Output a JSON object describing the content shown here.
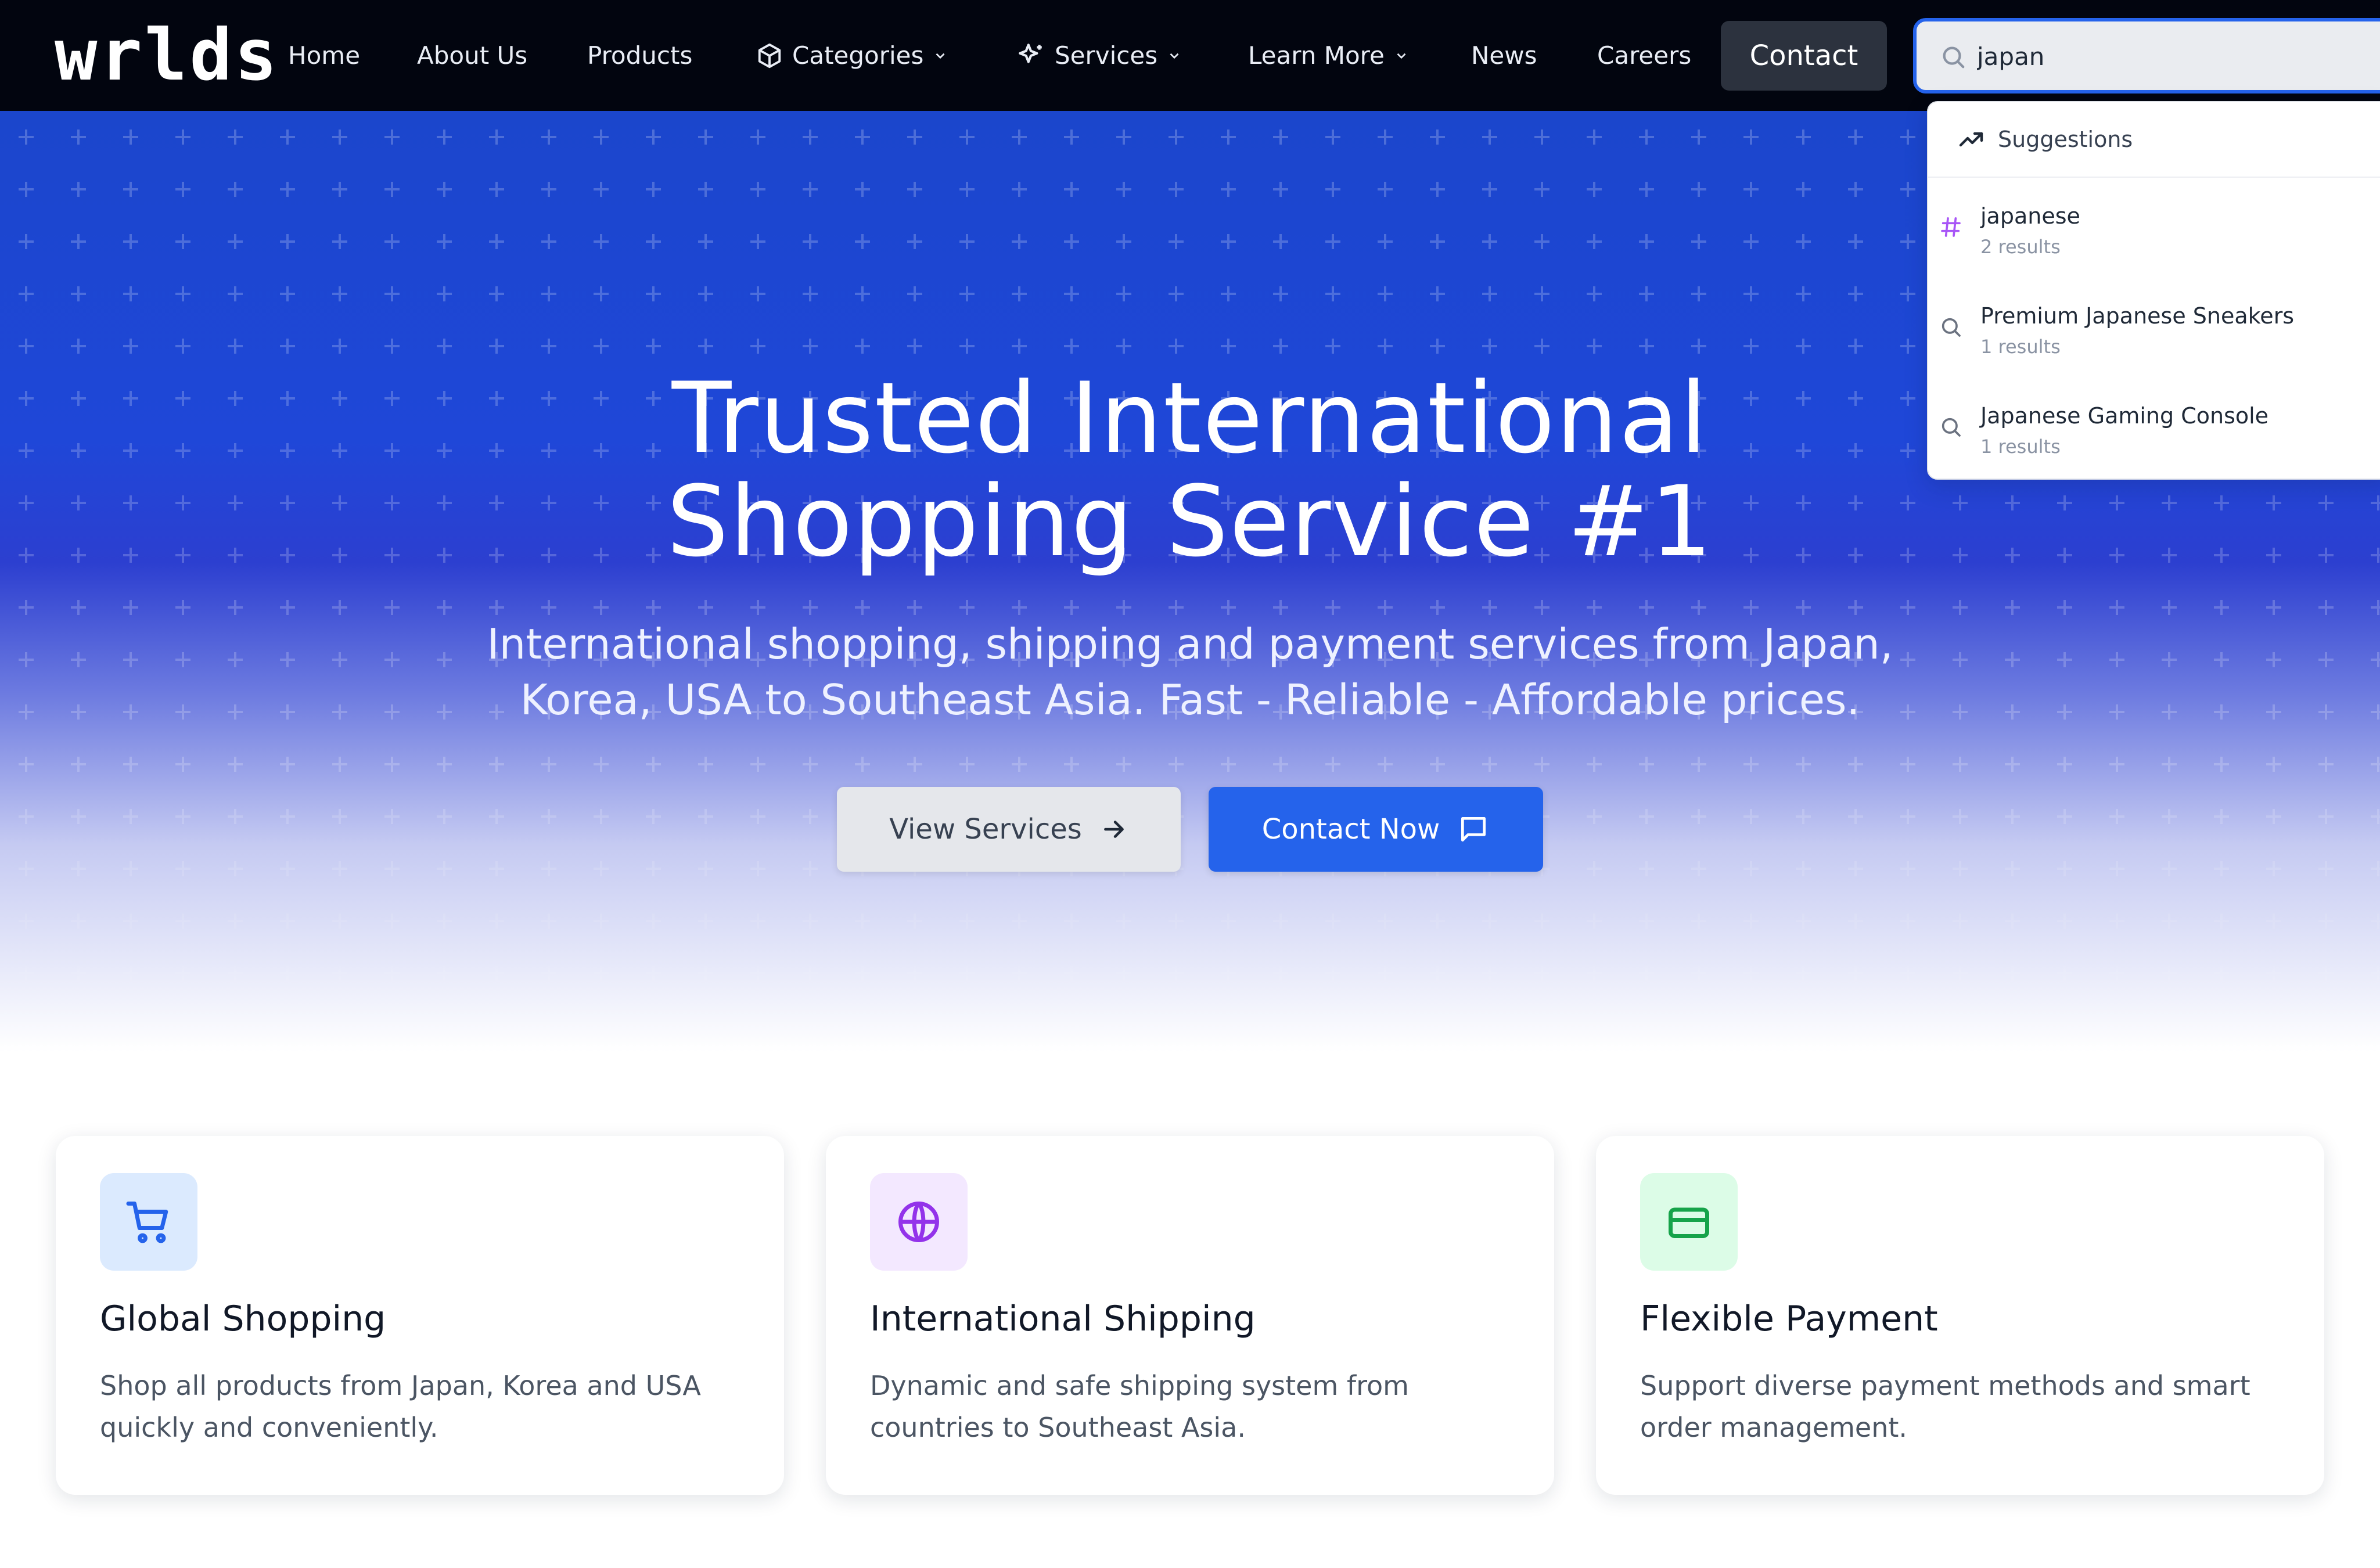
{
  "nav": {
    "logo": "wrlds",
    "home": "Home",
    "about": "About Us",
    "products": "Products",
    "categories": "Categories",
    "services": "Services",
    "learn_more": "Learn More",
    "news": "News",
    "careers": "Careers",
    "contact": "Contact"
  },
  "search": {
    "value": "japan",
    "suggestions_header": "Suggestions",
    "items": [
      {
        "title": "japanese",
        "sub": "2 results",
        "icon": "hash-icon"
      },
      {
        "title": "Premium Japanese Sneakers",
        "sub": "1 results",
        "icon": "search-icon"
      },
      {
        "title": "Japanese Gaming Console",
        "sub": "1 results",
        "icon": "search-icon"
      }
    ]
  },
  "hero": {
    "title_line1": "Trusted International",
    "title_line2": "Shopping Service #1",
    "subtitle": "International shopping, shipping and payment services from Japan, Korea, USA to Southeast Asia. Fast - Reliable - Affordable prices.",
    "view_services": "View Services",
    "contact_now": "Contact Now"
  },
  "features": [
    {
      "title": "Global Shopping",
      "desc": "Shop all products from Japan, Korea and USA quickly and conveniently.",
      "icon": "cart-icon",
      "color": "#2563eb",
      "bg": "#dbeafe"
    },
    {
      "title": "International Shipping",
      "desc": "Dynamic and safe shipping system from countries to Southeast Asia.",
      "icon": "globe-icon",
      "color": "#9333ea",
      "bg": "#f3e8ff"
    },
    {
      "title": "Flexible Payment",
      "desc": "Support diverse payment methods and smart order management.",
      "icon": "credit-card-icon",
      "color": "#16a34a",
      "bg": "#dcfce7"
    }
  ],
  "colors": {
    "nav_bg": "#02050f",
    "accent": "#2563eb",
    "hero_top": "#1b46cc"
  }
}
